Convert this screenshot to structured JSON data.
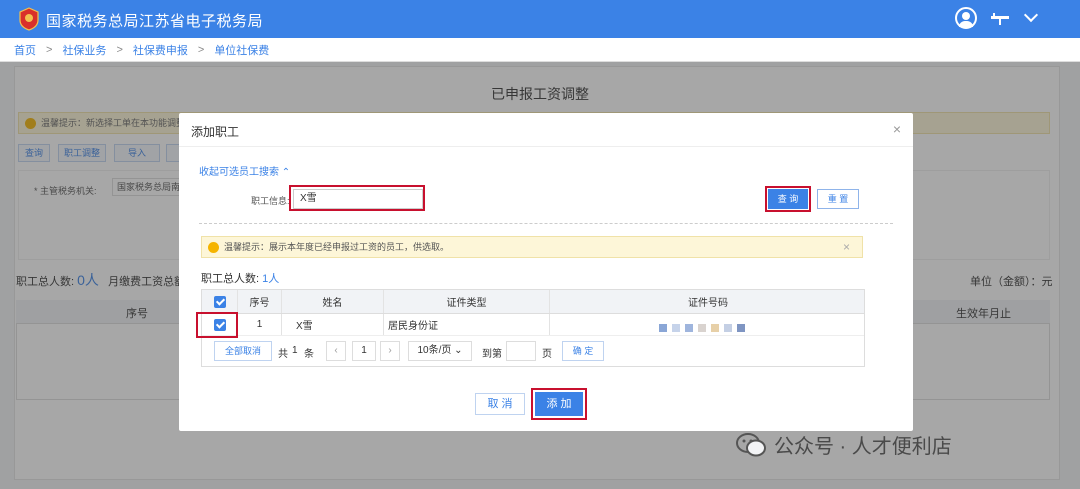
{
  "header": {
    "title": "国家税务总局江苏省电子税务局",
    "accent": "#3b82e6"
  },
  "breadcrumb": [
    "首页",
    "社保业务",
    "社保费申报",
    "单位社保费"
  ],
  "background": {
    "page_title": "已申报工资调整",
    "notice": "温馨提示：新选择工单在本功能调整",
    "buttons": [
      "查询",
      "职工调整",
      "导入",
      "导出"
    ],
    "filter_label": "* 主管税务机关:",
    "filter_value": "国家税务总局南通",
    "stats_label_1": "职工总人数:",
    "stats_value_1": "0人",
    "stats_label_2": "月缴费工资总额:",
    "unit": "单位（金额）：元",
    "col_seq": "序号",
    "col_effective": "生效年月止"
  },
  "modal": {
    "title": "添加职工",
    "close": "×",
    "collapse_link": "收起可选员工搜索 ⌃",
    "field_label": "职工信息:",
    "field_value": "X雪",
    "query_button": "查 询",
    "reset_button": "重 置",
    "tip": "温馨提示：展示本年度已经申报过工资的员工，供选取。",
    "tip_close": "×",
    "count_label": "职工总人数:",
    "count_value": "1人",
    "table": {
      "headers": [
        "序号",
        "姓名",
        "证件类型",
        "证件号码"
      ],
      "rows": [
        {
          "seq": "1",
          "name": "X雪",
          "id_type": "居民身份证",
          "id_number": ""
        }
      ]
    },
    "pager": {
      "cancel_all": "全部取消",
      "total_prefix": "共",
      "total_count": "1",
      "total_suffix": "条",
      "prev": "‹",
      "page": "1",
      "next": "›",
      "page_size": "10条/页 ⌄",
      "goto_label": "到第",
      "goto_suffix": "页",
      "confirm": "确 定"
    },
    "cancel_button": "取 消",
    "add_button": "添 加"
  },
  "watermark": "公众号 · 人才便利店"
}
